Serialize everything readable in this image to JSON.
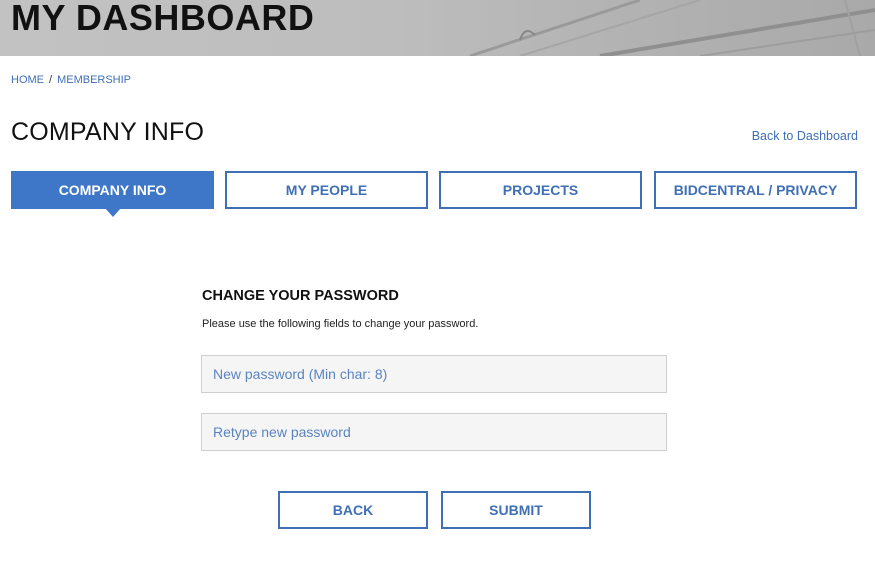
{
  "header": {
    "title": "MY DASHBOARD"
  },
  "breadcrumb": {
    "items": [
      "HOME",
      "MEMBERSHIP"
    ],
    "separator": "/"
  },
  "page": {
    "title": "COMPANY INFO",
    "back_link": "Back to Dashboard"
  },
  "tabs": [
    {
      "label": "COMPANY INFO",
      "active": true
    },
    {
      "label": "MY PEOPLE",
      "active": false
    },
    {
      "label": "PROJECTS",
      "active": false
    },
    {
      "label": "BIDCENTRAL / PRIVACY",
      "active": false
    }
  ],
  "form": {
    "title": "CHANGE YOUR PASSWORD",
    "description": "Please use the following fields to change your password.",
    "new_password": {
      "placeholder": "New password (Min char: 8)",
      "value": ""
    },
    "retype_password": {
      "placeholder": "Retype new password",
      "value": ""
    },
    "back_label": "BACK",
    "submit_label": "SUBMIT"
  },
  "colors": {
    "accent": "#3f6fb5",
    "active_tab": "#3f77c8",
    "banner": "#bdbdbd"
  }
}
